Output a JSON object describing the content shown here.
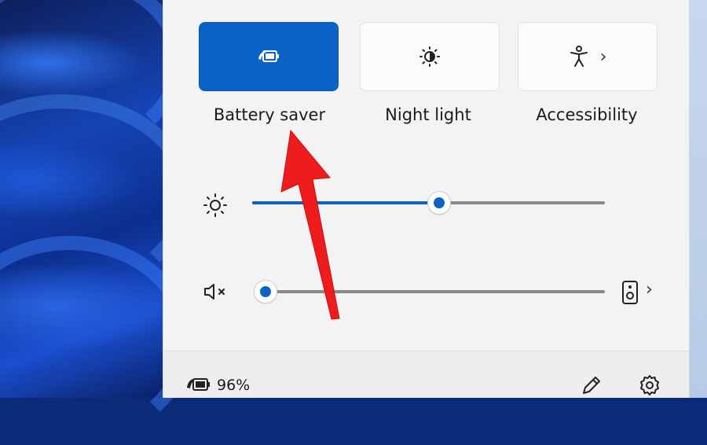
{
  "colors": {
    "accent": "#0a63c4",
    "panel": "#f3f3f3",
    "arrow": "#ee1c1c"
  },
  "quick_settings": {
    "tiles": [
      {
        "label": "Battery saver",
        "icon": "battery-saver-icon",
        "active": true
      },
      {
        "label": "Night light",
        "icon": "night-light-icon",
        "active": false
      },
      {
        "label": "Accessibility",
        "icon": "accessibility-icon",
        "active": false,
        "has_chevron": true
      }
    ],
    "brightness": {
      "icon": "brightness-icon",
      "level": 0.53
    },
    "volume": {
      "icon": "volume-muted-icon",
      "level": 0.0,
      "output_icon": "speaker-icon"
    }
  },
  "footer": {
    "battery_icon": "battery-saver-icon",
    "battery_percent": "96%",
    "edit_icon": "pencil-icon",
    "settings_icon": "gear-icon"
  },
  "annotation": {
    "icon": "red-arrow-icon",
    "points_to": "Battery saver"
  }
}
